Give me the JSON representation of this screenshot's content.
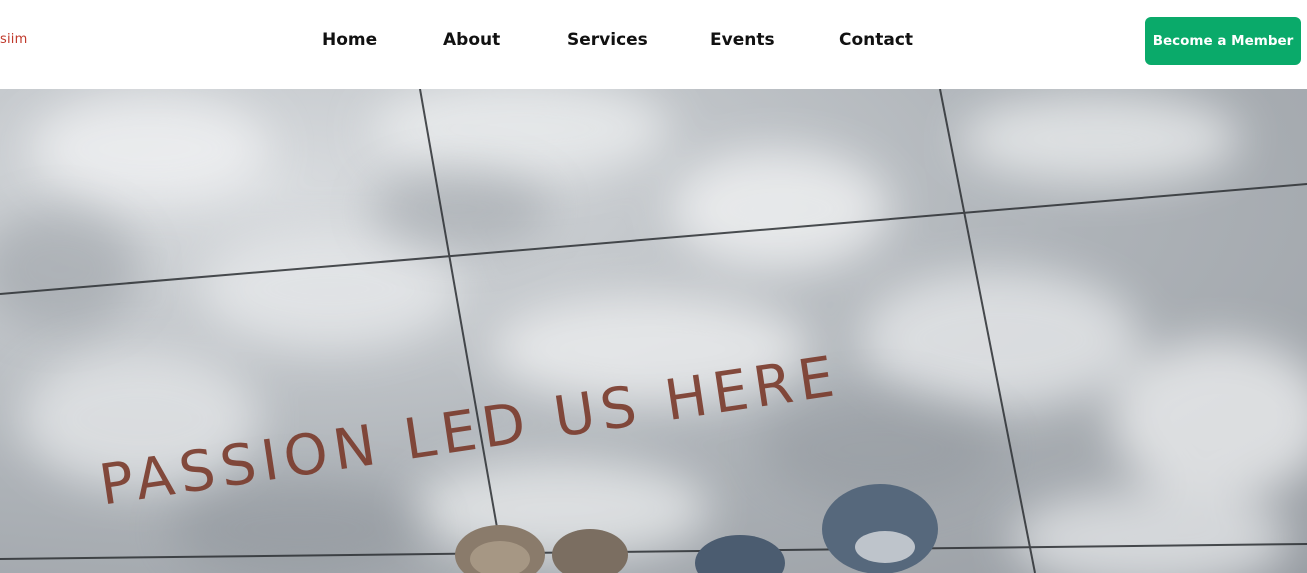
{
  "header": {
    "logo": "siim",
    "nav": [
      {
        "label": "Home"
      },
      {
        "label": "About"
      },
      {
        "label": "Services"
      },
      {
        "label": "Events"
      },
      {
        "label": "Contact"
      }
    ],
    "cta_label": "Become a Member",
    "cta_color": "#0aaa6a"
  },
  "hero": {
    "headline": "PASSION LED US HERE"
  }
}
